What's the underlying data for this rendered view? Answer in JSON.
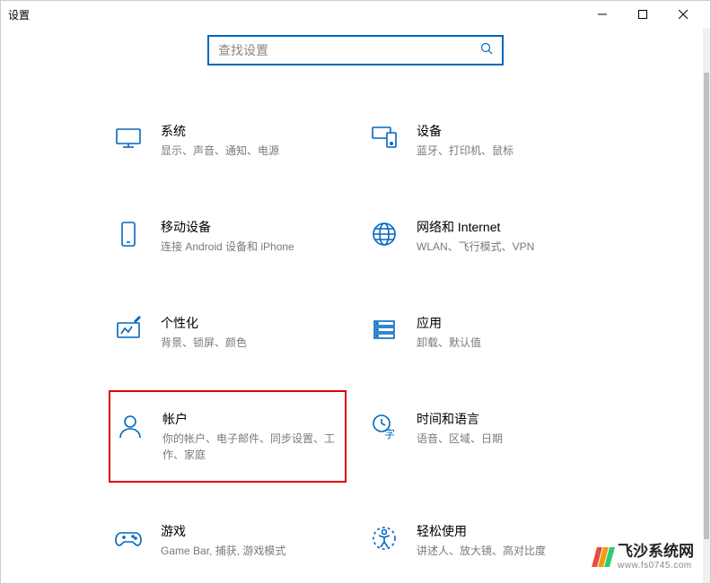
{
  "window": {
    "title": "设置"
  },
  "search": {
    "placeholder": "查找设置"
  },
  "tiles": {
    "system": {
      "title": "系统",
      "sub": "显示、声音、通知、电源"
    },
    "devices": {
      "title": "设备",
      "sub": "蓝牙、打印机、鼠标"
    },
    "mobile": {
      "title": "移动设备",
      "sub": "连接 Android 设备和 iPhone"
    },
    "network": {
      "title": "网络和 Internet",
      "sub": "WLAN、飞行模式、VPN"
    },
    "personal": {
      "title": "个性化",
      "sub": "背景、锁屏、颜色"
    },
    "apps": {
      "title": "应用",
      "sub": "卸载、默认值"
    },
    "accounts": {
      "title": "帐户",
      "sub": "你的帐户、电子邮件、同步设置、工作、家庭"
    },
    "timelang": {
      "title": "时间和语言",
      "sub": "语音、区域、日期"
    },
    "gaming": {
      "title": "游戏",
      "sub": "Game Bar, 捕获, 游戏模式"
    },
    "ease": {
      "title": "轻松使用",
      "sub": "讲述人、放大镜、高对比度"
    }
  },
  "watermark": {
    "name": "飞沙系统网",
    "url": "www.fs0745.com"
  }
}
